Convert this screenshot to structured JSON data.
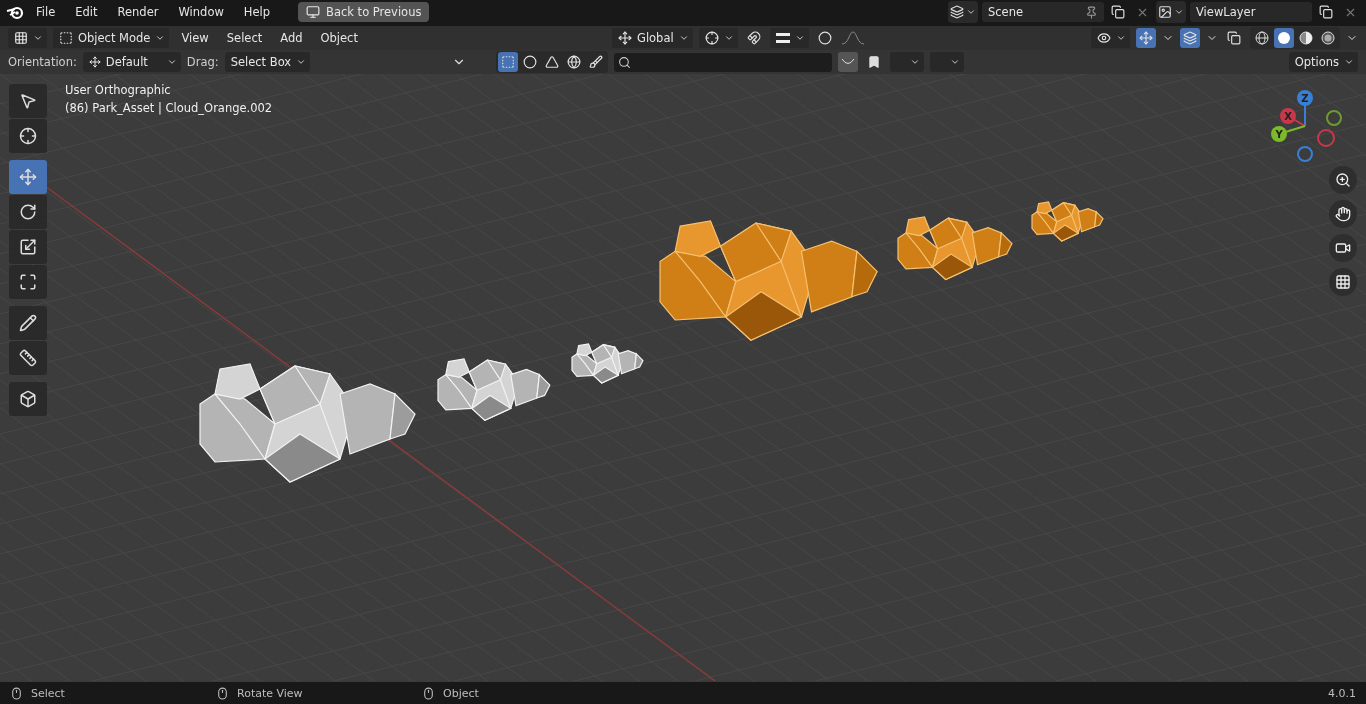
{
  "topbar": {
    "menus": [
      "File",
      "Edit",
      "Render",
      "Window",
      "Help"
    ],
    "back_button": "Back to Previous",
    "scene": "Scene",
    "view_layer": "ViewLayer"
  },
  "header": {
    "mode": "Object Mode",
    "menus": [
      "View",
      "Select",
      "Add",
      "Object"
    ],
    "orientation": "Global",
    "snap_on": false,
    "proportional_on": false,
    "gizmos_on": true,
    "overlays_on": true,
    "xray_on": false,
    "shading_modes": [
      {
        "kind": "wireframe",
        "selected": false
      },
      {
        "kind": "solid",
        "selected": true
      },
      {
        "kind": "material",
        "selected": false
      },
      {
        "kind": "rendered",
        "selected": false
      }
    ]
  },
  "tool_settings": {
    "orientation_label": "Orientation:",
    "orientation": "Default",
    "drag_label": "Drag:",
    "drag": "Select Box",
    "options": "Options",
    "filters": [
      {
        "kind": "object",
        "selected": true
      },
      {
        "kind": "material",
        "selected": false
      },
      {
        "kind": "geometry",
        "selected": false
      },
      {
        "kind": "world",
        "selected": false
      },
      {
        "kind": "brush",
        "selected": false
      }
    ]
  },
  "viewport": {
    "view_name": "User Orthographic",
    "object_info": "(86) Park_Asset | Cloud_Orange.002",
    "tool_groups": [
      [
        {
          "kind": "select_box",
          "selected": false
        },
        {
          "kind": "cursor",
          "selected": false
        }
      ],
      [
        {
          "kind": "move",
          "selected": true
        },
        {
          "kind": "rotate",
          "selected": false
        },
        {
          "kind": "scale",
          "selected": false
        },
        {
          "kind": "transform",
          "selected": false
        }
      ],
      [
        {
          "kind": "annotate",
          "selected": false
        },
        {
          "kind": "measure",
          "selected": false
        }
      ],
      [
        {
          "kind": "add_cube",
          "selected": false
        }
      ]
    ],
    "axes": [
      {
        "label": "X",
        "color": "#c8384a"
      },
      {
        "label": "Y",
        "color": "#7cba2a"
      },
      {
        "label": "Z",
        "color": "#3a7fd6"
      }
    ]
  },
  "status_bar": {
    "hints": [
      "Select",
      "Rotate View",
      "Object"
    ],
    "version": "4.0.1"
  }
}
